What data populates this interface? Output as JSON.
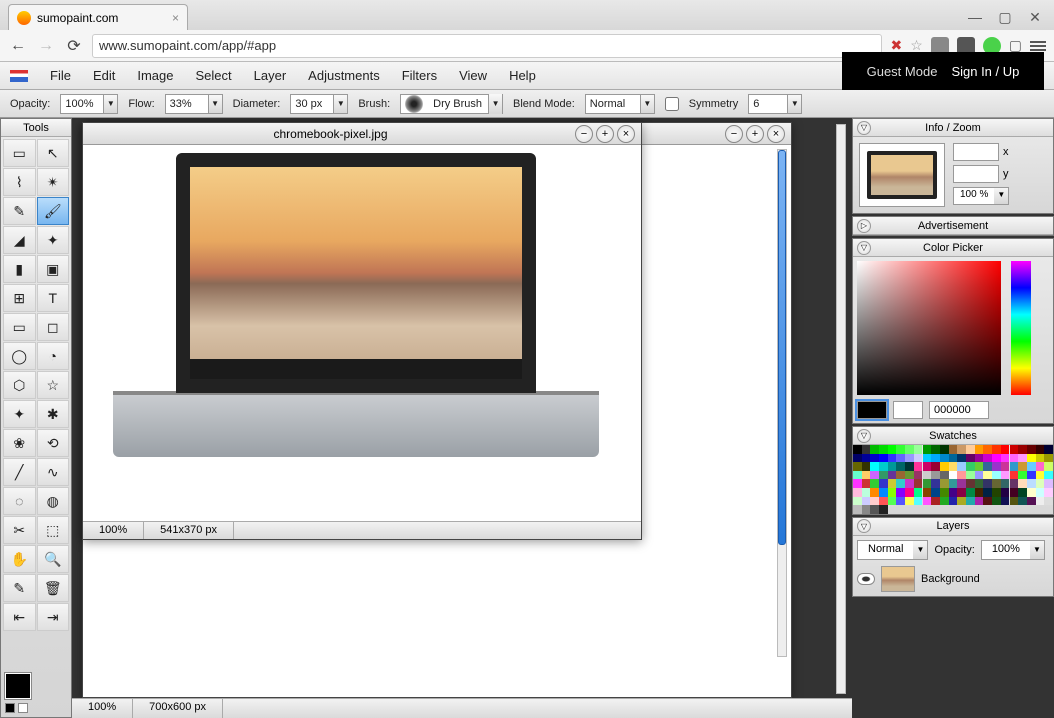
{
  "browser": {
    "tab_title": "sumopaint.com",
    "url_scheme": "",
    "url": "www.sumopaint.com/app/#app"
  },
  "menu": [
    "File",
    "Edit",
    "Image",
    "Select",
    "Layer",
    "Adjustments",
    "Filters",
    "View",
    "Help"
  ],
  "header": {
    "guest": "Guest Mode",
    "sign": "Sign In / Up"
  },
  "options": {
    "opacity_lbl": "Opacity:",
    "opacity": "100%",
    "flow_lbl": "Flow:",
    "flow": "33%",
    "diameter_lbl": "Diameter:",
    "diameter": "30 px",
    "brush_lbl": "Brush:",
    "brush": "Dry Brush",
    "blend_lbl": "Blend Mode:",
    "blend": "Normal",
    "sym_lbl": "Symmetry",
    "sym_val": "6"
  },
  "panels": {
    "tools_title": "Tools",
    "tool_names": [
      "marquee",
      "move",
      "lasso",
      "wand",
      "pencil",
      "brush",
      "eraser",
      "smudge",
      "gradient",
      "bucket",
      "clone",
      "text",
      "rect",
      "rounded-rect",
      "ellipse",
      "pie",
      "polygon",
      "star",
      "custom-star",
      "symmetry",
      "blob",
      "spiro",
      "line",
      "curve",
      "blur",
      "sharpen",
      "crop",
      "transform",
      "hand",
      "zoom",
      "color-picker",
      "trash",
      "nudge-left",
      "nudge-right"
    ],
    "tool_glyphs": [
      "▭",
      "↖",
      "⌇",
      "✴",
      "✎",
      "🖌",
      "◢",
      "✦",
      "▮",
      "▣",
      "⊞",
      "T",
      "▭",
      "◻",
      "◯",
      "◔",
      "⬡",
      "☆",
      "✦",
      "✱",
      "❀",
      "⟲",
      "╱",
      "∿",
      "◌",
      "◍",
      "✂",
      "⬚",
      "✋",
      "🔍",
      "✎",
      "🗑",
      "⇤",
      "⇥"
    ]
  },
  "doc": {
    "title": "chromebook-pixel.jpg",
    "front_zoom": "100%",
    "front_dim": "541x370 px",
    "back_zoom": "100%",
    "back_dim": "700x600 px"
  },
  "right": {
    "info_title": "Info / Zoom",
    "x": "x",
    "y": "y",
    "zoom": "100 %",
    "ad_title": "Advertisement",
    "cp_title": "Color Picker",
    "hex": "000000",
    "sw_title": "Swatches",
    "layers_title": "Layers",
    "layers_blend": "Normal",
    "layers_op_lbl": "Opacity:",
    "layers_op": "100%",
    "layer_name": "Background"
  },
  "swatch_colors": [
    "#000",
    "#333",
    "#0b0",
    "#0d0",
    "#0f0",
    "#3f3",
    "#6f6",
    "#9f9",
    "#090",
    "#060",
    "#030",
    "#963",
    "#c96",
    "#fc9",
    "#f90",
    "#f60",
    "#f30",
    "#f00",
    "#c00",
    "#900",
    "#600",
    "#300",
    "#003",
    "#006",
    "#009",
    "#00c",
    "#00f",
    "#33f",
    "#66f",
    "#99f",
    "#ccf",
    "#0cf",
    "#0af",
    "#08c",
    "#069",
    "#036",
    "#606",
    "#909",
    "#c0c",
    "#f0f",
    "#f3f",
    "#f6f",
    "#f9f",
    "#ff0",
    "#cc0",
    "#990",
    "#660",
    "#330",
    "#0ff",
    "#0cc",
    "#099",
    "#066",
    "#033",
    "#f39",
    "#c06",
    "#903",
    "#fc0",
    "#fd6",
    "#9cf",
    "#3c6",
    "#6c3",
    "#369",
    "#93c",
    "#c39",
    "#39c",
    "#c93",
    "#6cf",
    "#f6c",
    "#cf6",
    "#6fc",
    "#fc6",
    "#c6f",
    "#396",
    "#639",
    "#963",
    "#693",
    "#936",
    "#ccc",
    "#999",
    "#666",
    "#fff",
    "#f99",
    "#9f9",
    "#99f",
    "#ff9",
    "#9ff",
    "#f9f",
    "#f33",
    "#3f3",
    "#33f",
    "#ff3",
    "#3ff",
    "#f3f",
    "#c33",
    "#3c3",
    "#33c",
    "#cc3",
    "#3cc",
    "#c3c",
    "#933",
    "#393",
    "#339",
    "#993",
    "#399",
    "#939",
    "#633",
    "#363",
    "#336",
    "#663",
    "#366",
    "#636",
    "#fdb",
    "#bdf",
    "#dfb",
    "#dbf",
    "#fbd",
    "#bfd",
    "#f80",
    "#08f",
    "#8f0",
    "#80f",
    "#f08",
    "#0f8",
    "#840",
    "#048",
    "#480",
    "#408",
    "#804",
    "#084",
    "#420",
    "#024",
    "#240",
    "#204",
    "#402",
    "#042",
    "#ffc",
    "#cff",
    "#fcf",
    "#cfc",
    "#ccf",
    "#fcc",
    "#f55",
    "#5f5",
    "#55f",
    "#ff5",
    "#5ff",
    "#f5f",
    "#a22",
    "#2a2",
    "#22a",
    "#aa2",
    "#2aa",
    "#a2a",
    "#511",
    "#151",
    "#115",
    "#551",
    "#155",
    "#515",
    "#eee",
    "#ddd",
    "#bbb",
    "#888",
    "#555",
    "#222"
  ]
}
